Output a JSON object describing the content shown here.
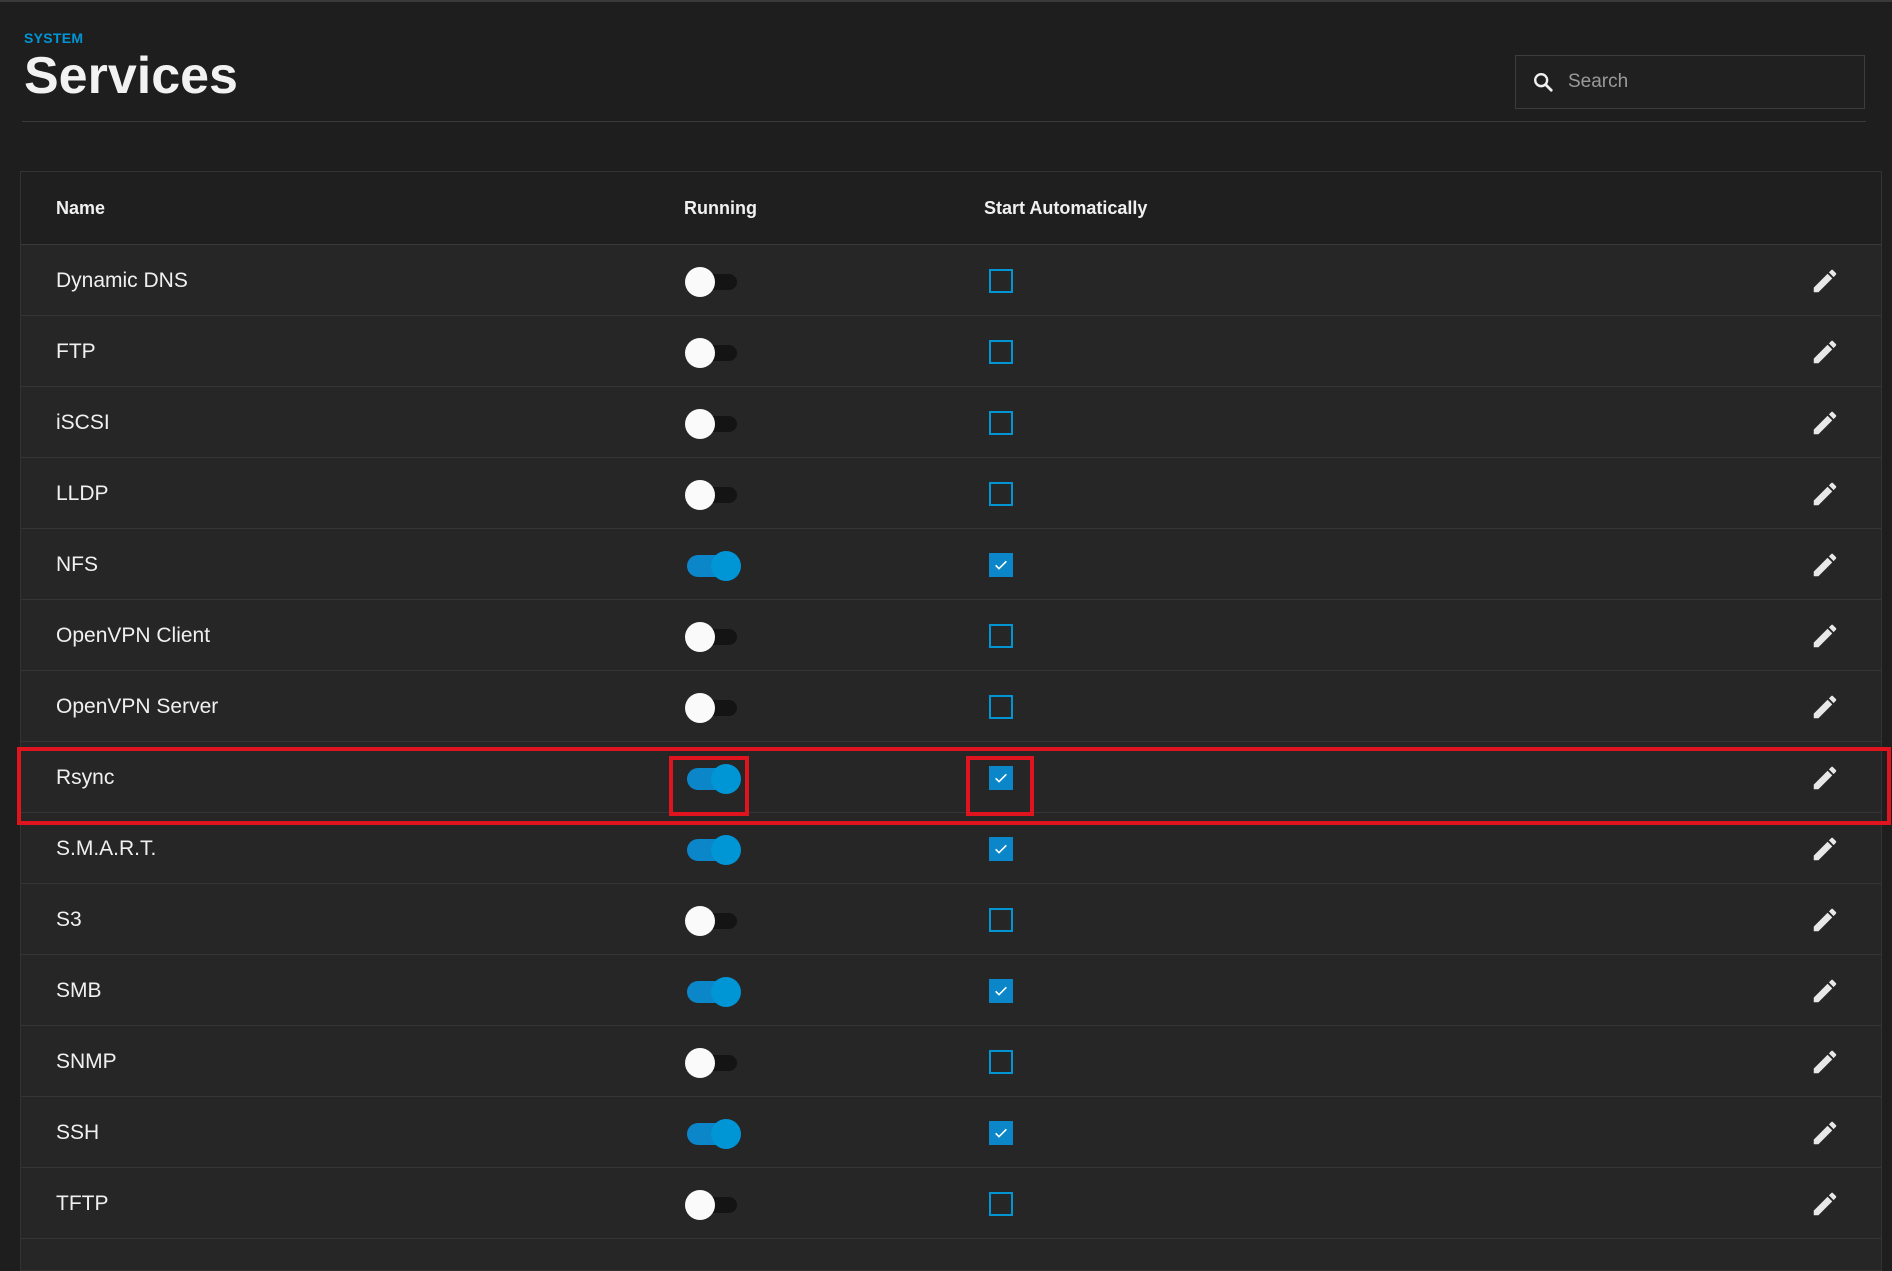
{
  "breadcrumb": "SYSTEM",
  "title": "Services",
  "search": {
    "placeholder": "Search"
  },
  "columns": {
    "name": "Name",
    "running": "Running",
    "start_automatically": "Start Automatically"
  },
  "colors": {
    "accent": "#0095d5",
    "highlight": "#e0141e",
    "background": "#1e1e1e"
  },
  "services": [
    {
      "name": "Dynamic DNS",
      "running": false,
      "start_automatically": false
    },
    {
      "name": "FTP",
      "running": false,
      "start_automatically": false
    },
    {
      "name": "iSCSI",
      "running": false,
      "start_automatically": false
    },
    {
      "name": "LLDP",
      "running": false,
      "start_automatically": false
    },
    {
      "name": "NFS",
      "running": true,
      "start_automatically": true
    },
    {
      "name": "OpenVPN Client",
      "running": false,
      "start_automatically": false
    },
    {
      "name": "OpenVPN Server",
      "running": false,
      "start_automatically": false
    },
    {
      "name": "Rsync",
      "running": true,
      "start_automatically": true,
      "highlighted": true
    },
    {
      "name": "S.M.A.R.T.",
      "running": true,
      "start_automatically": true
    },
    {
      "name": "S3",
      "running": false,
      "start_automatically": false
    },
    {
      "name": "SMB",
      "running": true,
      "start_automatically": true
    },
    {
      "name": "SNMP",
      "running": false,
      "start_automatically": false
    },
    {
      "name": "SSH",
      "running": true,
      "start_automatically": true
    },
    {
      "name": "TFTP",
      "running": false,
      "start_automatically": false
    }
  ],
  "row_actions": {
    "icon": "pencil-icon"
  }
}
